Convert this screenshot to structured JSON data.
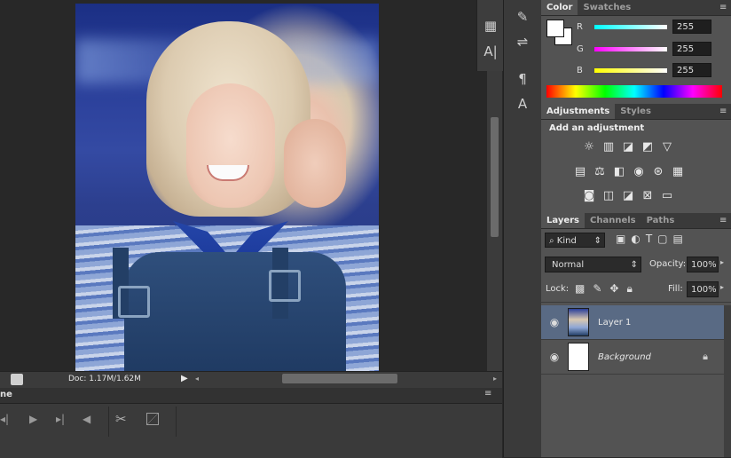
{
  "status": {
    "doc_info": "Doc: 1.17M/1.62M"
  },
  "timeline": {
    "partial_label": "ne"
  },
  "color_panel": {
    "tabs": [
      {
        "label": "Color"
      },
      {
        "label": "Swatches"
      }
    ],
    "channels": [
      {
        "label": "R",
        "value": "255",
        "color": "#00ffff"
      },
      {
        "label": "G",
        "value": "255",
        "color": "#ff00ff"
      },
      {
        "label": "B",
        "value": "255",
        "color": "#ffff00"
      }
    ]
  },
  "adjustments_panel": {
    "tabs": [
      {
        "label": "Adjustments"
      },
      {
        "label": "Styles"
      }
    ],
    "heading": "Add an adjustment"
  },
  "layers_panel": {
    "tabs": [
      {
        "label": "Layers"
      },
      {
        "label": "Channels"
      },
      {
        "label": "Paths"
      }
    ],
    "filter_kind": "Kind",
    "blend_mode": "Normal",
    "opacity_label": "Opacity:",
    "opacity_value": "100%",
    "lock_label": "Lock:",
    "fill_label": "Fill:",
    "fill_value": "100%",
    "layers": [
      {
        "name": "Layer 1",
        "selected": true
      },
      {
        "name": "Background",
        "selected": false
      }
    ]
  },
  "colors": {
    "panel_bg": "#535353",
    "selected_layer": "#596a84",
    "canvas_bg": "#282828"
  }
}
